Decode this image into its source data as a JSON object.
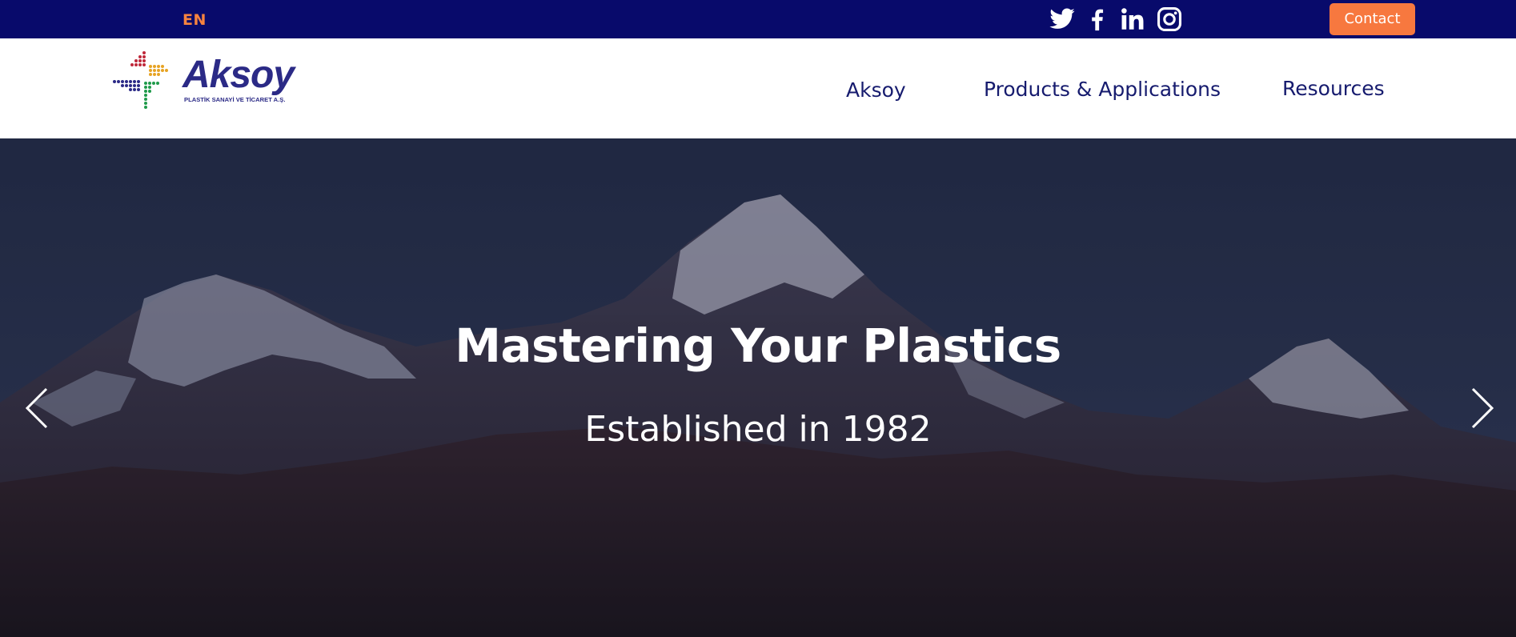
{
  "topbar": {
    "language": "EN",
    "social": [
      "twitter-icon",
      "facebook-icon",
      "linkedin-icon",
      "instagram-icon"
    ],
    "contact_label": "Contact"
  },
  "brand": {
    "name": "Aksoy",
    "tagline": "PLASTİK SANAYİ VE TİCARET A.Ş."
  },
  "nav": {
    "items": [
      "Aksoy",
      "Products & Applications",
      "Resources"
    ]
  },
  "hero": {
    "title": "Mastering Your Plastics",
    "subtitle": "Established in 1982",
    "prev_icon": "chevron-left-icon",
    "next_icon": "chevron-right-icon"
  },
  "colors": {
    "topbar": "#080a6b",
    "accent": "#f7783f",
    "nav_text": "#161b6e",
    "brand_text": "#2b2a86"
  }
}
